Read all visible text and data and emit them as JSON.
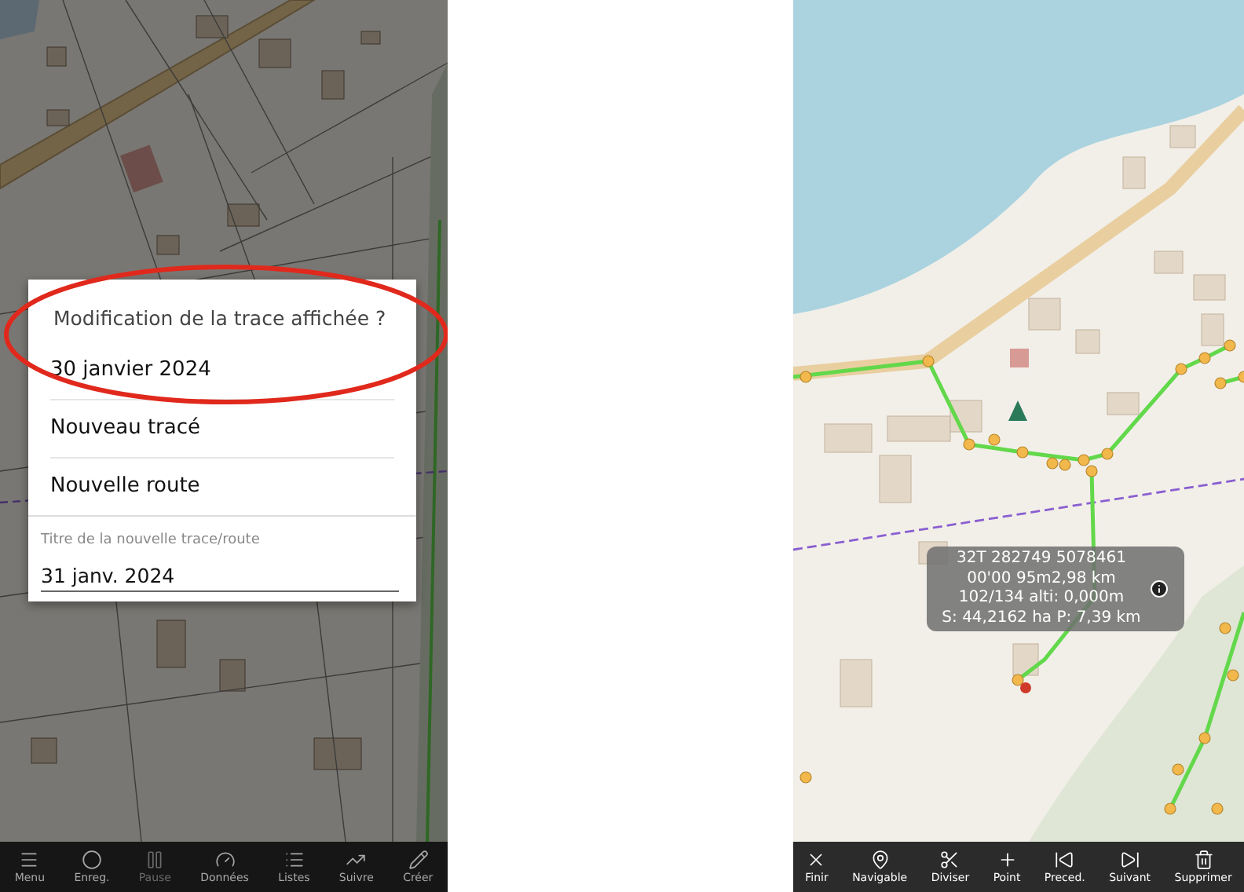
{
  "left_screen": {
    "dialog": {
      "title": "Modification de la trace affichée ?",
      "options": [
        {
          "label": "30 janvier 2024"
        },
        {
          "label": "Nouveau tracé"
        },
        {
          "label": "Nouvelle route"
        }
      ],
      "field": {
        "label": "Titre de la nouvelle trace/route",
        "value": "31 janv. 2024"
      }
    },
    "annotation": {
      "kind": "ellipse"
    },
    "toolbar": [
      {
        "label": "Menu",
        "disabled": false
      },
      {
        "label": "Enreg.",
        "disabled": false
      },
      {
        "label": "Pause",
        "disabled": true
      },
      {
        "label": "Données",
        "disabled": false
      },
      {
        "label": "Listes",
        "disabled": false
      },
      {
        "label": "Suivre",
        "disabled": false
      },
      {
        "label": "Créer",
        "disabled": false
      }
    ]
  },
  "right_screen": {
    "info_box": {
      "lines": [
        "32T 282749 5078461",
        "00'00  95m2,98 km",
        "102/134 alti: 0,000m",
        "S: 44,2162 ha P: 7,39 km"
      ]
    },
    "toolbar": [
      {
        "label": "Finir"
      },
      {
        "label": "Navigable"
      },
      {
        "label": "Diviser"
      },
      {
        "label": "Point"
      },
      {
        "label": "Preced."
      },
      {
        "label": "Suivant"
      },
      {
        "label": "Supprimer"
      }
    ]
  }
}
